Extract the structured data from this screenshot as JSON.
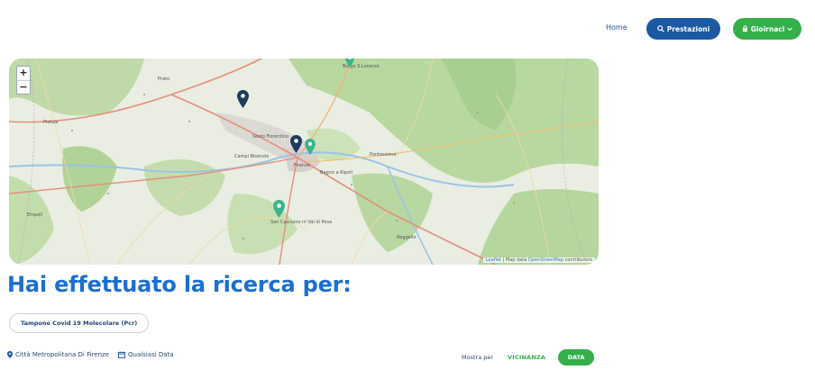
{
  "nav": {
    "home_label": "Home",
    "prestazioni_label": "Prestazioni",
    "giochi_label": "Gioirnaci",
    "brand_blue": "#1b59a3",
    "brand_green": "#34b04a"
  },
  "map": {
    "zoom_in": "+",
    "zoom_out": "−",
    "attribution_leaflet": "Leaflet",
    "attribution_text": "| Map data",
    "attribution_osm": "OpenStreetMap",
    "attribution_contrib": "contributors",
    "place_labels": [
      "Prato",
      "Pistoia",
      "Firenze",
      "Empoli",
      "Borgo S.Lorenzo",
      "San Casciano in Val di Pesa",
      "Pontassieve",
      "Campi Bisenzio",
      "Sesto Fiorentino",
      "Bagno a Ripoli",
      "Reggello"
    ],
    "marker_colors": [
      "#1d3b5c",
      "#1d3b5c",
      "#3bb48a",
      "#3bb48a",
      "#3bb48a"
    ]
  },
  "search": {
    "title": "Hai effettuato la ricerca per:",
    "tag": "Tampone Covid 19 Molecolare (Pcr)",
    "location": "Città Metropolitana Di Firenze",
    "date": "Qualsiasi Data"
  },
  "sort": {
    "label": "Mostra per",
    "vicinanza": "VICINANZA",
    "data": "DATA"
  }
}
